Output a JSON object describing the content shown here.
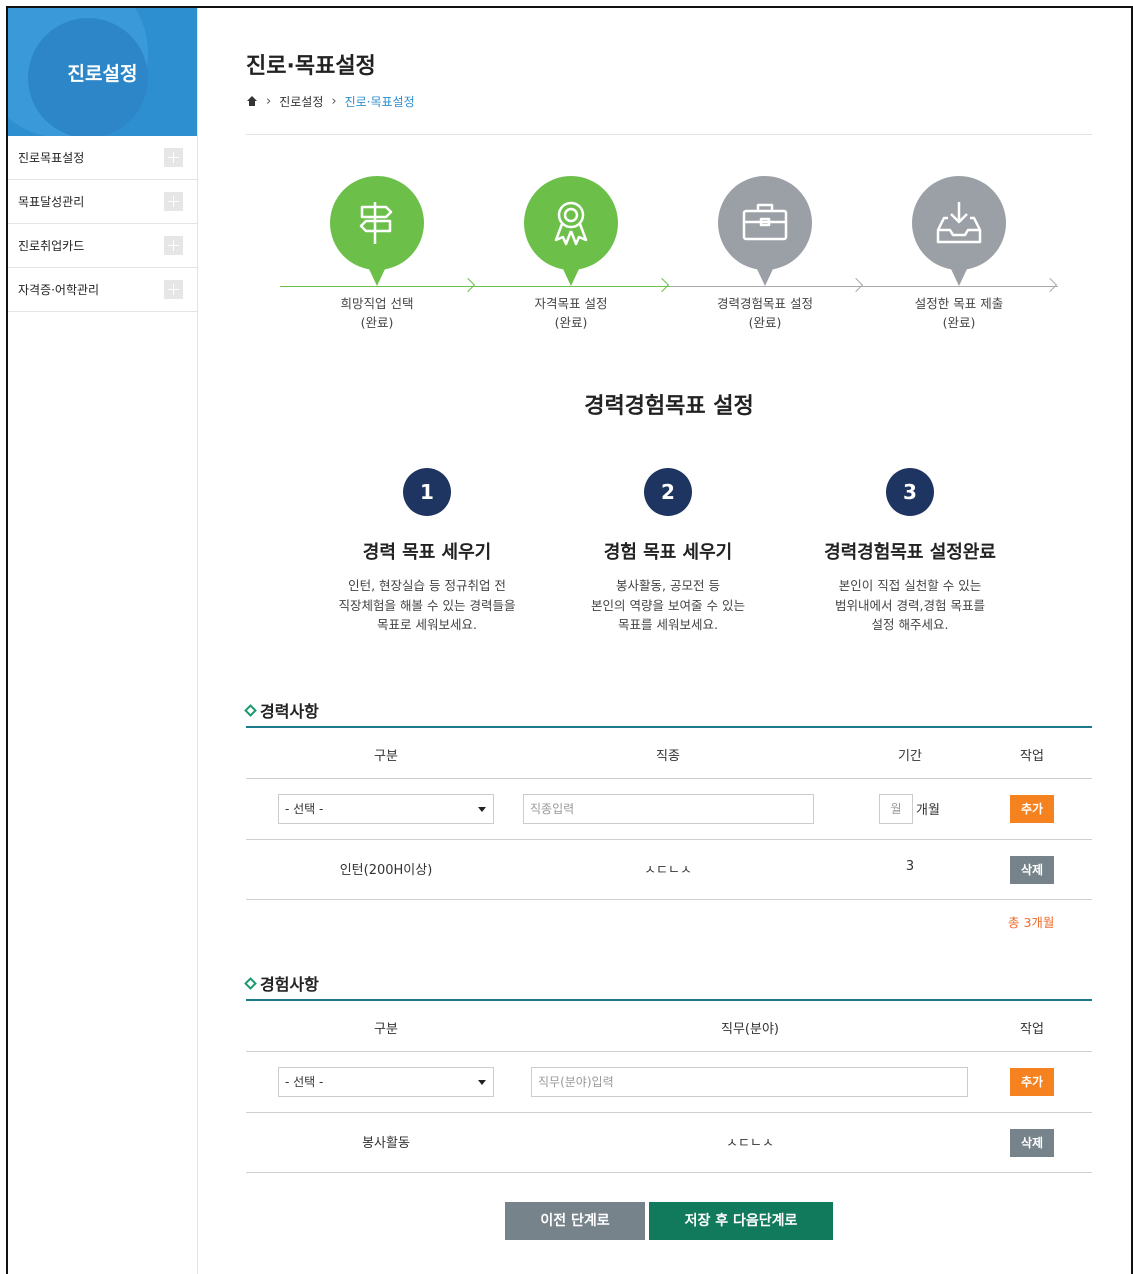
{
  "sidebar": {
    "title": "진로설정",
    "items": [
      {
        "label": "진로목표설정"
      },
      {
        "label": "목표달성관리"
      },
      {
        "label": "진로취업카드"
      },
      {
        "label": "자격증·어학관리"
      }
    ]
  },
  "header": {
    "title": "진로·목표설정",
    "breadcrumb": [
      "진로설정",
      "진로·목표설정"
    ]
  },
  "steps": [
    {
      "label": "희망직업 선택",
      "status": "(완료)",
      "icon": "signpost-icon",
      "color": "#6cc04a"
    },
    {
      "label": "자격목표 설정",
      "status": "(완료)",
      "icon": "award-ribbon-icon",
      "color": "#6cc04a"
    },
    {
      "label": "경력경험목표 설정",
      "status": "(완료)",
      "icon": "briefcase-icon",
      "color": "#9aa0a6"
    },
    {
      "label": "설정한 목표 제출",
      "status": "(완료)",
      "icon": "inbox-download-icon",
      "color": "#9aa0a6"
    }
  ],
  "section_title": "경력경험목표 설정",
  "guides": [
    {
      "num": "1",
      "title": "경력 목표 세우기",
      "lines": [
        "인턴, 현장실습 등 정규취업 전",
        "직장체험을 해볼 수 있는 경력들을",
        "목표로 세워보세요."
      ]
    },
    {
      "num": "2",
      "title": "경험 목표 세우기",
      "lines": [
        "봉사활동, 공모전 등",
        "본인의 역량을 보여줄 수 있는",
        "목표를 세워보세요."
      ]
    },
    {
      "num": "3",
      "title": "경력경험목표 설정완료",
      "lines": [
        "본인이 직접 실천할 수 있는",
        "범위내에서 경력,경험 목표를",
        "설정 해주세요."
      ]
    }
  ],
  "career": {
    "title": "경력사항",
    "headers": [
      "구분",
      "직종",
      "기간",
      "작업"
    ],
    "select_value": "- 선택 -",
    "job_placeholder": "직종입력",
    "month_placeholder": "월",
    "month_unit": "개월",
    "add_label": "추가",
    "rows": [
      {
        "type": "인턴(200H이상)",
        "job": "ㅅㄷㄴㅅ",
        "period": "3",
        "delete_label": "삭제"
      }
    ],
    "total": "총 3개월"
  },
  "experience": {
    "title": "경험사항",
    "headers": [
      "구분",
      "직무(분야)",
      "작업"
    ],
    "select_value": "- 선택 -",
    "field_placeholder": "직무(분야)입력",
    "add_label": "추가",
    "rows": [
      {
        "type": "봉사활동",
        "field": "ㅅㄷㄴㅅ",
        "delete_label": "삭제"
      }
    ]
  },
  "buttons": {
    "prev": "이전 단계로",
    "next": "저장 후 다음단계로"
  },
  "colors": {
    "sidebar_blue": "#2e8fd0",
    "step_done": "#6cc04a",
    "step_pending": "#9aa0a6",
    "number_badge": "#1d3560",
    "accent_orange": "#f5821f",
    "next_green": "#127a5c"
  }
}
